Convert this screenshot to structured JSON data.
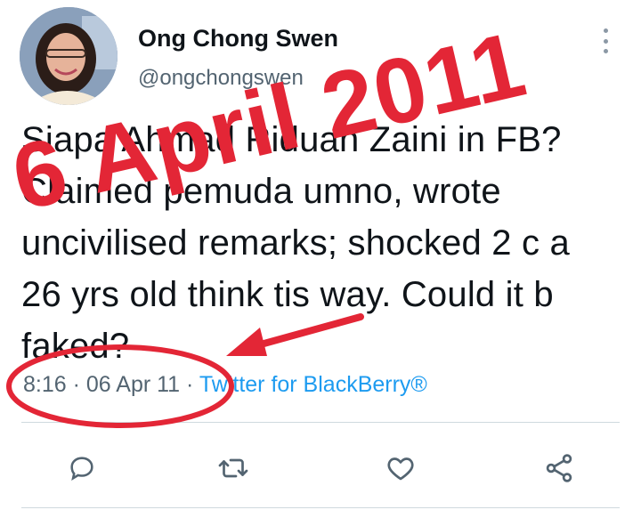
{
  "author": {
    "name": "Ong Chong Swen",
    "handle": "@ongchongswen"
  },
  "tweet": {
    "lines": [
      "Siapa Ahmad Riduan Zaini in FB?",
      "Claimed pemuda umno, wrote",
      "uncivilised remarks; shocked 2 c a",
      "26 yrs old think tis way. Could it b",
      "faked?"
    ]
  },
  "meta": {
    "time": "8:16",
    "separator": "·",
    "date": "06 Apr 11",
    "source": "Twitter for BlackBerry®"
  },
  "overlay": {
    "text": "6 April 2011",
    "color": "#e32636"
  },
  "actions": {
    "icons": [
      "reply-icon",
      "retweet-icon",
      "like-icon",
      "share-icon"
    ]
  },
  "colors": {
    "text": "#0f1419",
    "secondary": "#536471",
    "link": "#1d9bf0",
    "annotation": "#e32636"
  }
}
